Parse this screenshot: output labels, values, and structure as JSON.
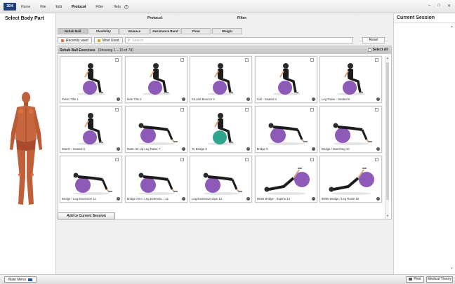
{
  "app": {
    "logo": "3D4"
  },
  "menu": [
    {
      "label": "Home",
      "active": false
    },
    {
      "label": "File",
      "active": false
    },
    {
      "label": "Edit",
      "active": false
    },
    {
      "label": "Protocol",
      "active": true
    },
    {
      "label": "Filter",
      "active": false
    },
    {
      "label": "Help",
      "active": false
    }
  ],
  "window_controls": [
    "–",
    "□",
    "✕"
  ],
  "left_panel": {
    "title": "Select Body Part"
  },
  "right_panel": {
    "title": "Current Session"
  },
  "criteria": {
    "protocol_label": "Protocol:",
    "filter_label": "Filter:"
  },
  "tabs": [
    {
      "label": "Rehab Ball",
      "active": true
    },
    {
      "label": "Flexibility",
      "active": false
    },
    {
      "label": "Balance",
      "active": false
    },
    {
      "label": "Resistance Band",
      "active": false
    },
    {
      "label": "Floor",
      "active": false
    },
    {
      "label": "Weight",
      "active": false
    }
  ],
  "filters": {
    "recently_used": "Recently used",
    "most_used": "Most Used",
    "search_placeholder": "Search",
    "reset": "Reset",
    "recently_color": "#e06a3b",
    "most_color": "#d2a326"
  },
  "grid": {
    "title": "Rehab Ball Exercises",
    "showing": "(Showing 1 – 15 of 78)",
    "select_all": "Select All"
  },
  "exercises": [
    {
      "caption": "Pelvic Tilts  1",
      "ball": "#8e5ab8",
      "pose": "sit"
    },
    {
      "caption": "Side Tilts  2",
      "ball": "#8e5ab8",
      "pose": "sit-front"
    },
    {
      "caption": "Sit and Bounce  3",
      "ball": "#8e5ab8",
      "pose": "sit"
    },
    {
      "caption": "Roll - Seated  4",
      "ball": "#8e5ab8",
      "pose": "sit"
    },
    {
      "caption": "Leg Raise - Seated  5",
      "ball": "#8e5ab8",
      "pose": "sit"
    },
    {
      "caption": "March - Seated  6",
      "ball": "#8e5ab8",
      "pose": "sit"
    },
    {
      "caption": "Static Sit Up Leg Raise  7",
      "ball": "#8e5ab8",
      "pose": "bridge"
    },
    {
      "caption": "To Bridge  8",
      "ball": "#2fa58e",
      "pose": "sit"
    },
    {
      "caption": "Bridge  9",
      "ball": "#8e5ab8",
      "pose": "bridge"
    },
    {
      "caption": "Bridge / Marching  10",
      "ball": "#8e5ab8",
      "pose": "bridge"
    },
    {
      "caption": "Bridge / Leg Extension  11",
      "ball": "#8e5ab8",
      "pose": "bridge"
    },
    {
      "caption": "Bridge Arm / Leg Extensio...  12",
      "ball": "#8e5ab8",
      "pose": "bridge"
    },
    {
      "caption": "Leg Extension Dips  13",
      "ball": "#8e5ab8",
      "pose": "bridge"
    },
    {
      "caption": "90/90 Bridge - Supine  14",
      "ball": "#8e5ab8",
      "pose": "supine"
    },
    {
      "caption": "90/90 Bridge / Leg Raise  15",
      "ball": "#8e5ab8",
      "pose": "supine"
    }
  ],
  "add_button": "Add to Current Session",
  "bottom": {
    "main_menu": "Main Menu",
    "print": "Print",
    "medical_theory": "Medical Theory"
  }
}
